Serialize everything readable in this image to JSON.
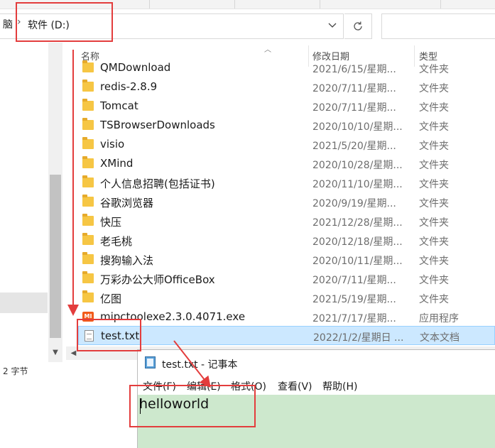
{
  "address": {
    "prev_crumb": "脑",
    "current_crumb": "软件 (D:)"
  },
  "columns": {
    "name": "名称",
    "date": "修改日期",
    "type": "类型"
  },
  "files": [
    {
      "name": "QMDownload",
      "date": "2021/6/15/星期...",
      "type": "文件夹",
      "kind": "folder"
    },
    {
      "name": "redis-2.8.9",
      "date": "2020/7/11/星期...",
      "type": "文件夹",
      "kind": "folder"
    },
    {
      "name": "Tomcat",
      "date": "2020/7/11/星期...",
      "type": "文件夹",
      "kind": "folder"
    },
    {
      "name": "TSBrowserDownloads",
      "date": "2020/10/10/星期...",
      "type": "文件夹",
      "kind": "folder"
    },
    {
      "name": "visio",
      "date": "2021/5/20/星期...",
      "type": "文件夹",
      "kind": "folder"
    },
    {
      "name": "XMind",
      "date": "2020/10/28/星期...",
      "type": "文件夹",
      "kind": "folder"
    },
    {
      "name": "个人信息招聘(包括证书)",
      "date": "2020/11/10/星期...",
      "type": "文件夹",
      "kind": "folder"
    },
    {
      "name": "谷歌浏览器",
      "date": "2020/9/19/星期...",
      "type": "文件夹",
      "kind": "folder"
    },
    {
      "name": "快压",
      "date": "2021/12/28/星期...",
      "type": "文件夹",
      "kind": "folder"
    },
    {
      "name": "老毛桃",
      "date": "2020/12/18/星期...",
      "type": "文件夹",
      "kind": "folder"
    },
    {
      "name": "搜狗输入法",
      "date": "2020/10/11/星期...",
      "type": "文件夹",
      "kind": "folder"
    },
    {
      "name": "万彩办公大师OfficeBox",
      "date": "2020/7/11/星期...",
      "type": "文件夹",
      "kind": "folder"
    },
    {
      "name": "亿图",
      "date": "2021/5/19/星期...",
      "type": "文件夹",
      "kind": "folder"
    },
    {
      "name": "mipctoolexe2.3.0.4071.exe",
      "date": "2021/7/17/星期...",
      "type": "应用程序",
      "kind": "exe",
      "icon_text": "MI"
    },
    {
      "name": "test.txt",
      "date": "2022/1/2/星期日 ...",
      "type": "文本文档",
      "kind": "txt",
      "selected": true
    }
  ],
  "status_text": "2 字节",
  "notepad": {
    "title": "test.txt - 记事本",
    "menu": [
      "文件(F)",
      "编辑(E)",
      "格式(O)",
      "查看(V)",
      "帮助(H)"
    ],
    "content": "helloworld"
  },
  "colors": {
    "annotation": "#e33d3d",
    "selection": "#cce8ff",
    "editor_bg": "#cde8cd",
    "folder": "#f6c644"
  },
  "icons": {
    "chevron_down": "chevron-down-icon",
    "refresh": "refresh-icon",
    "folder": "folder-icon",
    "exe": "application-icon",
    "txt": "text-document-icon",
    "notepad": "notepad-icon"
  }
}
